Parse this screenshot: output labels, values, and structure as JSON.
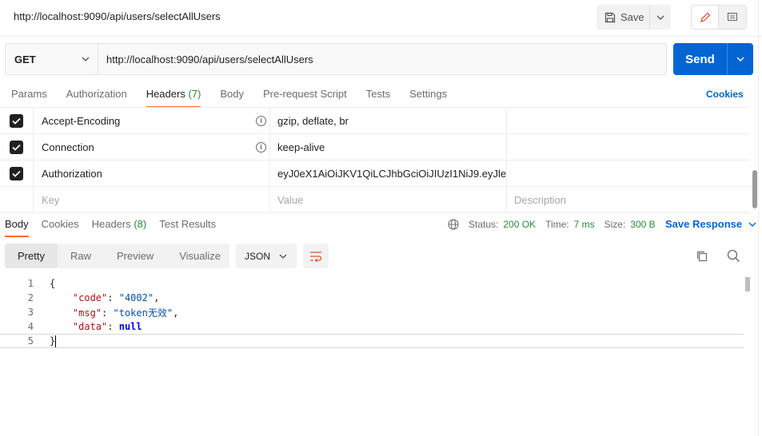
{
  "request": {
    "title": "http://localhost:9090/api/users/selectAllUsers",
    "method": "GET",
    "url": "http://localhost:9090/api/users/selectAllUsers",
    "save_label": "Save",
    "send_label": "Send"
  },
  "request_tabs": [
    {
      "label": "Params",
      "count": ""
    },
    {
      "label": "Authorization",
      "count": ""
    },
    {
      "label": "Headers",
      "count": "(7)"
    },
    {
      "label": "Body",
      "count": ""
    },
    {
      "label": "Pre-request Script",
      "count": ""
    },
    {
      "label": "Tests",
      "count": ""
    },
    {
      "label": "Settings",
      "count": ""
    }
  ],
  "cookies_label": "Cookies",
  "headers": [
    {
      "key": "Accept-Encoding",
      "value": "gzip, deflate, br",
      "description": "",
      "checked": true
    },
    {
      "key": "Connection",
      "value": "keep-alive",
      "description": "",
      "checked": true
    },
    {
      "key": "Authorization",
      "value": "eyJ0eX1AiOiJKV1QiLCJhbGciOiJIUzI1NiJ9.eyJle...",
      "description": "",
      "checked": true
    }
  ],
  "header_placeholders": {
    "key": "Key",
    "value": "Value",
    "description": "Description"
  },
  "response_tabs": [
    {
      "label": "Body",
      "count": ""
    },
    {
      "label": "Cookies",
      "count": ""
    },
    {
      "label": "Headers",
      "count": "(8)"
    },
    {
      "label": "Test Results",
      "count": ""
    }
  ],
  "response_meta": {
    "status_label": "Status:",
    "status_value": "200 OK",
    "time_label": "Time:",
    "time_value": "7 ms",
    "size_label": "Size:",
    "size_value": "300 B",
    "save_response": "Save Response"
  },
  "format_tabs": [
    "Pretty",
    "Raw",
    "Preview",
    "Visualize"
  ],
  "format_language": "JSON",
  "code_lines": [
    {
      "n": "1",
      "text": "{"
    },
    {
      "n": "2",
      "key": "\"code\"",
      "val": "\"4002\"",
      "type": "s",
      "trail": ","
    },
    {
      "n": "3",
      "key": "\"msg\"",
      "val": "\"token无效\"",
      "type": "s",
      "trail": ","
    },
    {
      "n": "4",
      "key": "\"data\"",
      "val": "null",
      "type": "n",
      "trail": ""
    },
    {
      "n": "5",
      "text": "}"
    }
  ],
  "colors": {
    "accent": "#ff6c37",
    "primary": "#0265d2",
    "success": "#2b8a3e"
  }
}
